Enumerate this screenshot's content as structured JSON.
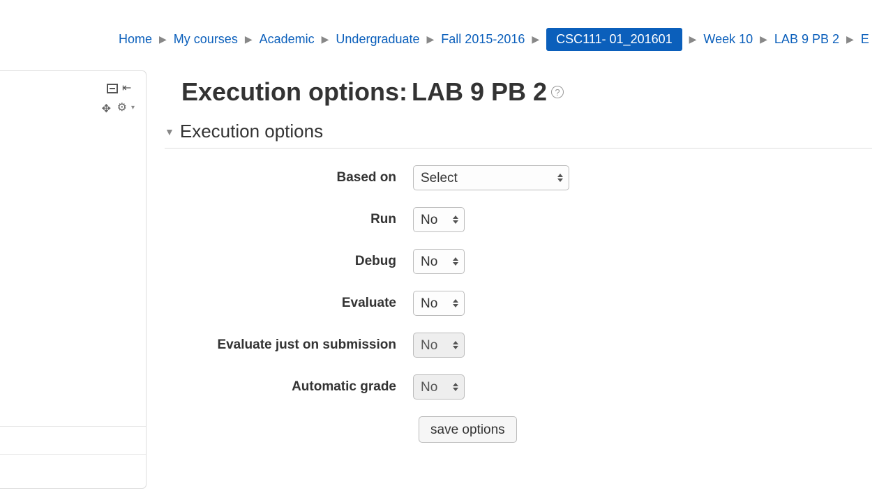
{
  "breadcrumb": {
    "home": "Home",
    "mycourses": "My courses",
    "academic": "Academic",
    "undergrad": "Undergraduate",
    "term": "Fall 2015-2016",
    "course": "CSC111- 01_201601",
    "week": "Week 10",
    "lab": "LAB 9 PB 2",
    "tail": "E"
  },
  "page": {
    "title_prefix": "Execution options: ",
    "title_name": "LAB 9 PB 2"
  },
  "section": {
    "title": "Execution options"
  },
  "form": {
    "based_on": {
      "label": "Based on",
      "value": "Select"
    },
    "run": {
      "label": "Run",
      "value": "No"
    },
    "debug": {
      "label": "Debug",
      "value": "No"
    },
    "evaluate": {
      "label": "Evaluate",
      "value": "No"
    },
    "eval_submit": {
      "label": "Evaluate just on submission",
      "value": "No"
    },
    "auto_grade": {
      "label": "Automatic grade",
      "value": "No"
    },
    "save_button": "save options"
  }
}
